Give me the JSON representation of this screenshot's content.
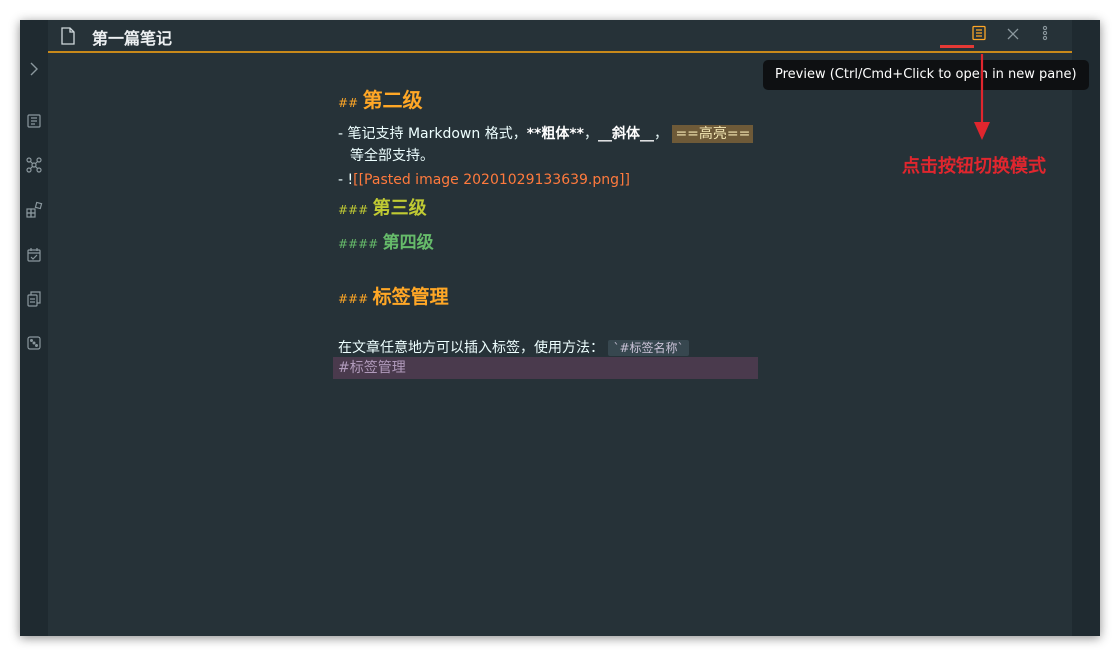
{
  "tab": {
    "title": "第一篇笔记"
  },
  "tooltip": {
    "text": "Preview (Ctrl/Cmd+Click to open in new pane)"
  },
  "annotation": {
    "text": "点击按钮切换模式",
    "color": "#e0262e"
  },
  "editor": {
    "h2_mark": "##",
    "h2_text": "第二级",
    "li1_prefix": "- 笔记支持 Markdown 格式，",
    "li1_bold": "**粗体**",
    "li1_sep1": "，",
    "li1_italic": "__斜体__",
    "li1_sep2": "，",
    "li1_highlight": "==高亮==",
    "li1_cont": "等全部支持。",
    "li2_prefix": "- !",
    "li2_link": "[[Pasted image 20201029133639.png]]",
    "h3_mark": "###",
    "h3_text": "第三级",
    "h4_mark": "####",
    "h4_text": "第四级",
    "h3b_mark": "###",
    "h3b_text": "标签管理",
    "para_text": "在文章任意地方可以插入标签，使用方法：",
    "para_code": "`#标签名称`",
    "tag_line": "#标签管理"
  },
  "colors": {
    "bg": "#263238",
    "accent": "#c8891a",
    "h2": "#ffa726",
    "h3": "#c0ca33",
    "h4": "#66bb6a",
    "link": "#ff7a3d"
  },
  "icons": {
    "ribbon": [
      "chevron-right-icon",
      "outline-icon",
      "graph-icon",
      "blocks-icon",
      "calendar-check-icon",
      "copy-doc-icon",
      "dice-icon"
    ],
    "header": [
      "document-icon",
      "preview-toggle-icon",
      "close-icon",
      "more-options-icon"
    ]
  }
}
